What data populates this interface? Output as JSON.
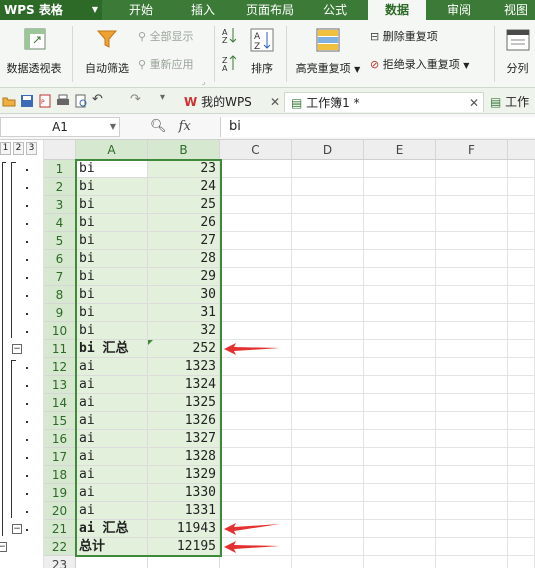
{
  "menu": {
    "app": "WPS 表格",
    "tabs": [
      "开始",
      "插入",
      "页面布局",
      "公式",
      "数据",
      "审阅",
      "视图"
    ],
    "active": "数据"
  },
  "ribbon": {
    "pivot": "数据透视表",
    "autofilter": "自动筛选",
    "showall": "全部显示",
    "reapply": "重新应用",
    "sort": "排序",
    "highlight_dup": "高亮重复项",
    "remove_dup": "删除重复项",
    "reject_dup": "拒绝录入重复项",
    "split": "分列"
  },
  "tabs": {
    "wps": "我的WPS",
    "book1": "工作簿1 *",
    "book2": "工作"
  },
  "formula": {
    "cellref": "A1",
    "fx": "fx",
    "value": "bi"
  },
  "outline_levels": [
    "1",
    "2",
    "3"
  ],
  "columns": [
    "A",
    "B",
    "C",
    "D",
    "E",
    "F"
  ],
  "rows": [
    {
      "n": "1",
      "a": "bi",
      "b": "23"
    },
    {
      "n": "2",
      "a": "bi",
      "b": "24"
    },
    {
      "n": "3",
      "a": "bi",
      "b": "25"
    },
    {
      "n": "4",
      "a": "bi",
      "b": "26"
    },
    {
      "n": "5",
      "a": "bi",
      "b": "27"
    },
    {
      "n": "6",
      "a": "bi",
      "b": "28"
    },
    {
      "n": "7",
      "a": "bi",
      "b": "29"
    },
    {
      "n": "8",
      "a": "bi",
      "b": "30"
    },
    {
      "n": "9",
      "a": "bi",
      "b": "31"
    },
    {
      "n": "10",
      "a": "bi",
      "b": "32"
    },
    {
      "n": "11",
      "a": "bi 汇总",
      "b": "252",
      "bold": true
    },
    {
      "n": "12",
      "a": "ai",
      "b": "1323"
    },
    {
      "n": "13",
      "a": "ai",
      "b": "1324"
    },
    {
      "n": "14",
      "a": "ai",
      "b": "1325"
    },
    {
      "n": "15",
      "a": "ai",
      "b": "1326"
    },
    {
      "n": "16",
      "a": "ai",
      "b": "1327"
    },
    {
      "n": "17",
      "a": "ai",
      "b": "1328"
    },
    {
      "n": "18",
      "a": "ai",
      "b": "1329"
    },
    {
      "n": "19",
      "a": "ai",
      "b": "1330"
    },
    {
      "n": "20",
      "a": "ai",
      "b": "1331"
    },
    {
      "n": "21",
      "a": "ai 汇总",
      "b": "11943",
      "bold": true
    },
    {
      "n": "22",
      "a": "总计",
      "b": "12195",
      "bold": true
    },
    {
      "n": "23",
      "a": "",
      "b": ""
    }
  ],
  "colors": {
    "menubar": "#3c7a37",
    "selection": "#3f8a3a",
    "arrow": "#e53030"
  }
}
